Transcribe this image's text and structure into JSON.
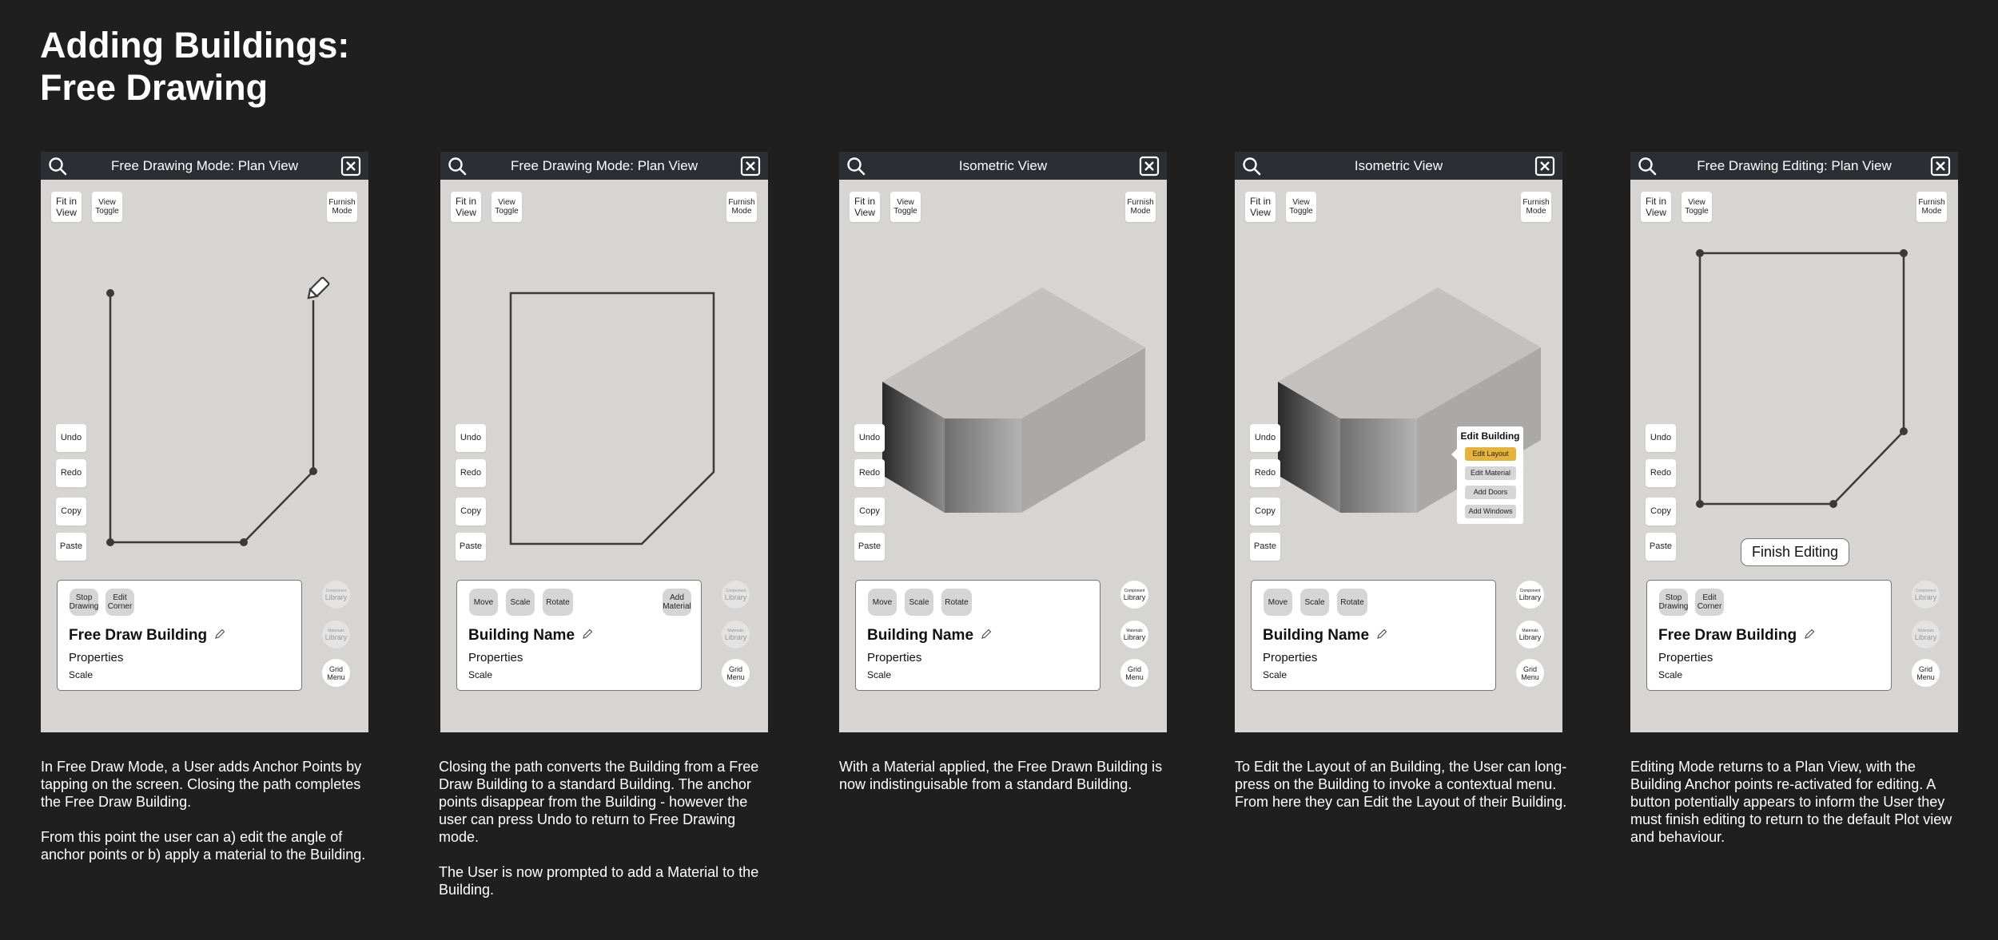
{
  "header": {
    "title_line1": "Adding Buildings:",
    "title_line2": "Free Drawing"
  },
  "common": {
    "fit_label": "Fit in View",
    "view_label": "View Toggle",
    "furnish_label": "Furnish Mode",
    "undo": "Undo",
    "redo": "Redo",
    "copy": "Copy",
    "paste": "Paste",
    "properties": "Properties",
    "scale": "Scale",
    "component_small": "Component",
    "materials_small": "Materials",
    "library": "Library",
    "grid_menu": "Grid Menu",
    "move": "Move",
    "rotate": "Rotate"
  },
  "screens": [
    {
      "title": "Free Drawing Mode: Plan View",
      "building_name": "Free Draw Building",
      "chip_stop": "Stop Drawing",
      "chip_edit_corner": "Edit Corner",
      "caption": [
        "In Free Draw Mode, a User adds Anchor Points by tapping on the screen. Closing the path completes the Free Draw Building.",
        "From this point the user can a) edit the angle of anchor points or b) apply a material to the Building."
      ]
    },
    {
      "title": "Free Drawing Mode: Plan View",
      "building_name": "Building Name",
      "add_material": "Add Material",
      "caption": [
        "Closing the path converts the Building from a Free Draw Building to a standard Building. The anchor points disappear from the Building - however the user can press Undo to return to Free Drawing mode.",
        "The User is now prompted to add a Material to the Building."
      ]
    },
    {
      "title": "Isometric View",
      "building_name": "Building Name",
      "caption": [
        "With a Material applied, the Free Drawn Building is now indistinguisable from a standard Building."
      ]
    },
    {
      "title": "Isometric View",
      "building_name": "Building Name",
      "menu": {
        "title": "Edit Building",
        "items": [
          "Edit Layout",
          "Edit Material",
          "Add Doors",
          "Add Windows"
        ]
      },
      "caption": [
        "To Edit the Layout of an Building, the User can long-press on the Building to invoke a contextual menu. From here they can Edit the Layout of their Building."
      ]
    },
    {
      "title": "Free Drawing Editing: Plan View",
      "building_name": "Free Draw Building",
      "chip_stop": "Stop Drawing",
      "chip_edit_corner": "Edit Corner",
      "finish_editing": "Finish Editing",
      "caption": [
        "Editing Mode returns to a Plan View, with the Building Anchor points re-activated for editing. A button potentially appears to inform the User they must finish editing to return to the default Plot view and behaviour."
      ]
    }
  ],
  "colors": {
    "background": "#1f1f1f",
    "panel": "#d6d5d3",
    "titlebar": "#2b2e33",
    "accent": "#e8b33a"
  },
  "icons": [
    "search-icon",
    "close-icon",
    "pencil-icon",
    "edit-name-icon"
  ]
}
